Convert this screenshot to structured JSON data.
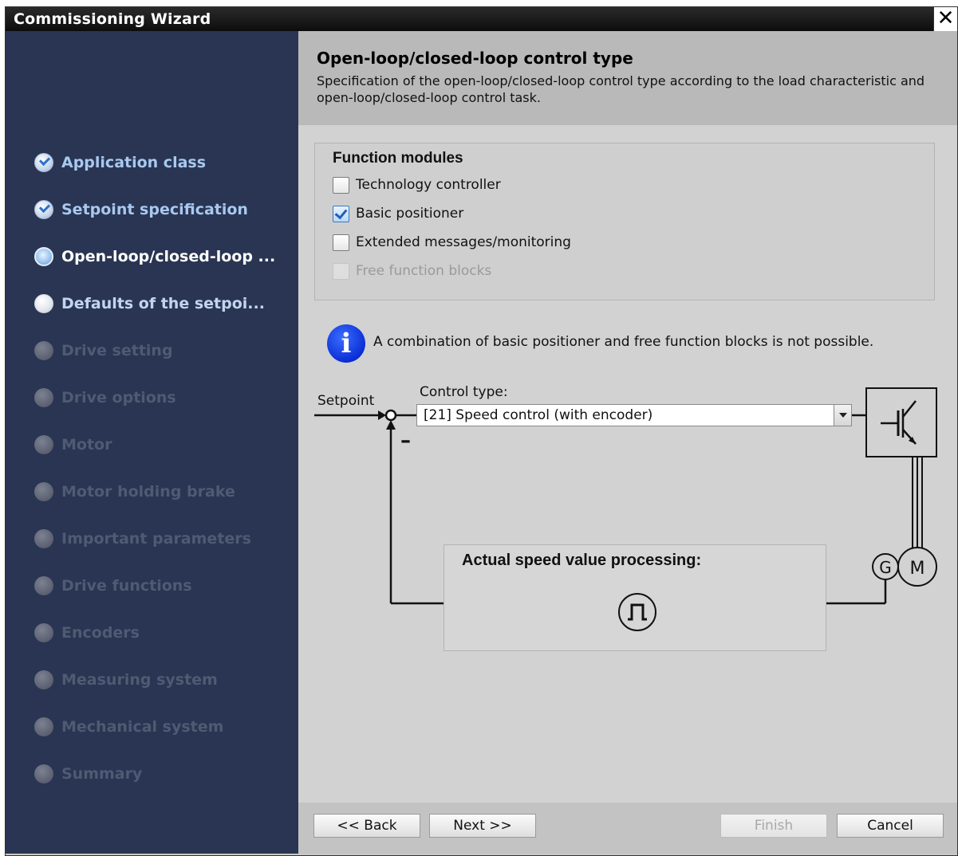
{
  "window": {
    "title": "Commissioning Wizard",
    "close_glyph": "✕"
  },
  "sidebar": {
    "items": [
      {
        "label": "Application class",
        "state": "done"
      },
      {
        "label": "Setpoint specification",
        "state": "done"
      },
      {
        "label": "Open-loop/closed-loop ...",
        "state": "current"
      },
      {
        "label": "Defaults of the setpoi...",
        "state": "next"
      },
      {
        "label": "Drive setting",
        "state": "pending"
      },
      {
        "label": "Drive options",
        "state": "pending"
      },
      {
        "label": "Motor",
        "state": "pending"
      },
      {
        "label": "Motor holding brake",
        "state": "pending"
      },
      {
        "label": "Important parameters",
        "state": "pending"
      },
      {
        "label": "Drive functions",
        "state": "pending"
      },
      {
        "label": "Encoders",
        "state": "pending"
      },
      {
        "label": "Measuring system",
        "state": "pending"
      },
      {
        "label": "Mechanical system",
        "state": "pending"
      },
      {
        "label": "Summary",
        "state": "pending"
      }
    ]
  },
  "header": {
    "title": "Open-loop/closed-loop control type",
    "description": "Specification of the open-loop/closed-loop control type according to the load characteristic and open-loop/closed-loop control task."
  },
  "function_modules": {
    "title": "Function modules",
    "options": [
      {
        "label": "Technology controller",
        "checked": false,
        "enabled": true
      },
      {
        "label": "Basic positioner",
        "checked": true,
        "enabled": true
      },
      {
        "label": "Extended messages/monitoring",
        "checked": false,
        "enabled": true
      },
      {
        "label": "Free function blocks",
        "checked": false,
        "enabled": false
      }
    ]
  },
  "info": {
    "icon": "info-icon",
    "glyph": "i",
    "message": "A combination of basic positioner and free function blocks is not possible."
  },
  "diagram": {
    "setpoint_label": "Setpoint",
    "minus_sign": "–",
    "control_type_label": "Control type:",
    "control_type_value": "[21] Speed control (with encoder)",
    "actual_value_title": "Actual speed value processing:",
    "generator_label": "G",
    "motor_label": "M"
  },
  "footer": {
    "back_label": "<< Back",
    "next_label": "Next >>",
    "finish_label": "Finish",
    "cancel_label": "Cancel"
  },
  "colors": {
    "sidebar_bg": "#293552",
    "header_bg": "#b9b9b9",
    "content_bg": "#d2d2d2",
    "info_blue": "#0a2fd6",
    "titlebar_bg": "#111111"
  }
}
